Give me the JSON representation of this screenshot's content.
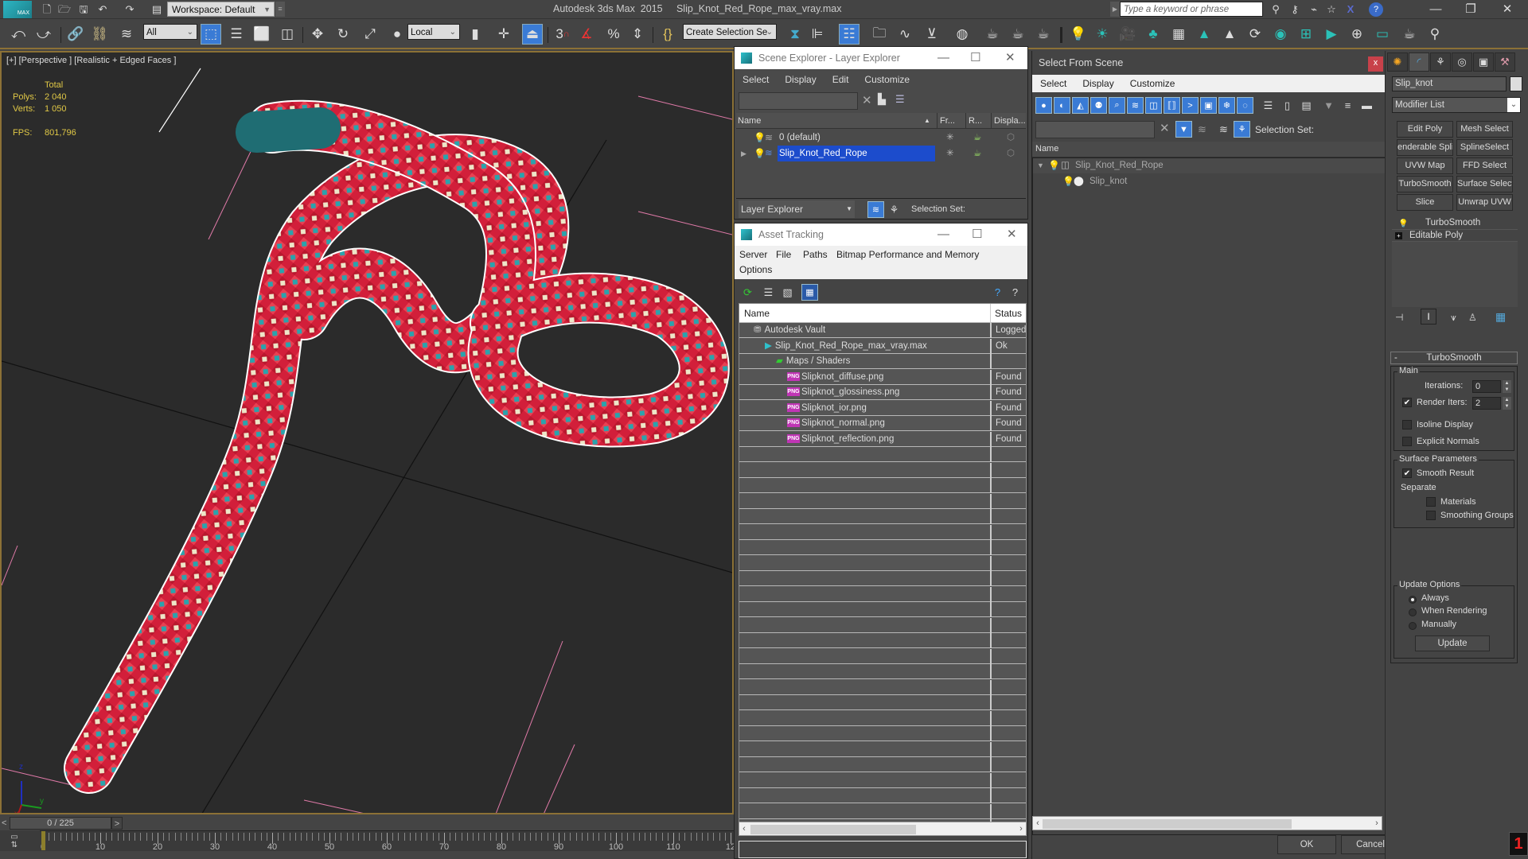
{
  "app": {
    "title": "Autodesk 3ds Max  2015",
    "file": "Slip_Knot_Red_Rope_max_vray.max",
    "logo": "MAX",
    "workspace": "Workspace: Default",
    "search_placeholder": "Type a keyword or phrase"
  },
  "main_toolbar": {
    "selection_filter": "All",
    "ref_coord": "Local",
    "named_selection": "Create Selection Se",
    "snap_label": "3"
  },
  "viewport": {
    "label": "[+] [Perspective ] [Realistic + Edged Faces ]",
    "stats": {
      "header": "Total",
      "polys_label": "Polys:",
      "polys": "2 040",
      "verts_label": "Verts:",
      "verts": "1 050",
      "fps_label": "FPS:",
      "fps": "801,796"
    },
    "axis": {
      "x": "x",
      "y": "y",
      "z": "z"
    }
  },
  "timeline": {
    "frame_display": "0 / 225",
    "current_frame": 0,
    "total_frames": 225,
    "ruler_labels": [
      "0",
      "10",
      "20",
      "30",
      "40",
      "50",
      "60",
      "70",
      "80",
      "90",
      "100",
      "110",
      "12"
    ]
  },
  "scene_explorer": {
    "title": "Scene Explorer - Layer Explorer",
    "menu": [
      "Select",
      "Display",
      "Edit",
      "Customize"
    ],
    "columns": [
      "Name",
      "Fr...",
      "R...",
      "Displa..."
    ],
    "rows": [
      {
        "name": "0 (default)",
        "selected": false
      },
      {
        "name": "Slip_Knot_Red_Rope",
        "selected": true
      }
    ],
    "footer_dropdown": "Layer Explorer",
    "selection_set_label": "Selection Set:"
  },
  "asset_tracking": {
    "title": "Asset Tracking",
    "menu": [
      "Server",
      "File",
      "Paths",
      "Bitmap Performance and Memory",
      "Options"
    ],
    "columns": [
      "Name",
      "Status"
    ],
    "rows": [
      {
        "name": "Autodesk Vault",
        "status": "Logged O",
        "icon": "vault-icon",
        "indent": 1
      },
      {
        "name": "Slip_Knot_Red_Rope_max_vray.max",
        "status": "Ok",
        "icon": "max-file-icon",
        "indent": 2
      },
      {
        "name": "Maps / Shaders",
        "status": "",
        "icon": "maps-icon",
        "indent": 3
      },
      {
        "name": "Slipknot_diffuse.png",
        "status": "Found",
        "icon": "png-icon",
        "indent": 4
      },
      {
        "name": "Slipknot_glossiness.png",
        "status": "Found",
        "icon": "png-icon",
        "indent": 4
      },
      {
        "name": "Slipknot_ior.png",
        "status": "Found",
        "icon": "png-icon",
        "indent": 4
      },
      {
        "name": "Slipknot_normal.png",
        "status": "Found",
        "icon": "png-icon",
        "indent": 4
      },
      {
        "name": "Slipknot_reflection.png",
        "status": "Found",
        "icon": "png-icon",
        "indent": 4
      }
    ],
    "png_badge": "PNG"
  },
  "select_from_scene": {
    "title": "Select From Scene",
    "close": "x",
    "menu": [
      "Select",
      "Display",
      "Customize"
    ],
    "selection_set_label": "Selection Set:",
    "column": "Name",
    "tree": [
      {
        "name": "Slip_Knot_Red_Rope",
        "level": 0
      },
      {
        "name": "Slip_knot",
        "level": 1
      }
    ],
    "ok": "OK",
    "cancel": "Cancel"
  },
  "command_panel": {
    "object_name": "Slip_knot",
    "modifier_list": "Modifier List",
    "modifier_buttons": [
      "Edit Poly",
      "Mesh Select",
      "enderable Splin",
      "SplineSelect",
      "UVW Map",
      "FFD Select",
      "TurboSmooth",
      "Surface Select",
      "Slice",
      "Unwrap UVW"
    ],
    "stack": [
      "TurboSmooth",
      "Editable Poly"
    ],
    "rollout": {
      "title": "TurboSmooth",
      "collapse": "-",
      "main_label": "Main",
      "iterations_label": "Iterations:",
      "iterations": "0",
      "render_iters_label": "Render Iters:",
      "render_iters": "2",
      "render_iters_checked": true,
      "isoline_label": "Isoline Display",
      "isoline_checked": false,
      "explicit_normals_label": "Explicit Normals",
      "explicit_normals_checked": false,
      "surface_label": "Surface Parameters",
      "smooth_result_label": "Smooth Result",
      "smooth_result_checked": true,
      "separate_label": "Separate",
      "materials_label": "Materials",
      "materials_checked": false,
      "smoothing_groups_label": "Smoothing Groups",
      "smoothing_groups_checked": false,
      "update_label": "Update Options",
      "update_options": [
        "Always",
        "When Rendering",
        "Manually"
      ],
      "update_selected": "Always",
      "update_button": "Update"
    },
    "badge": "1",
    "check_glyph": "✔"
  }
}
